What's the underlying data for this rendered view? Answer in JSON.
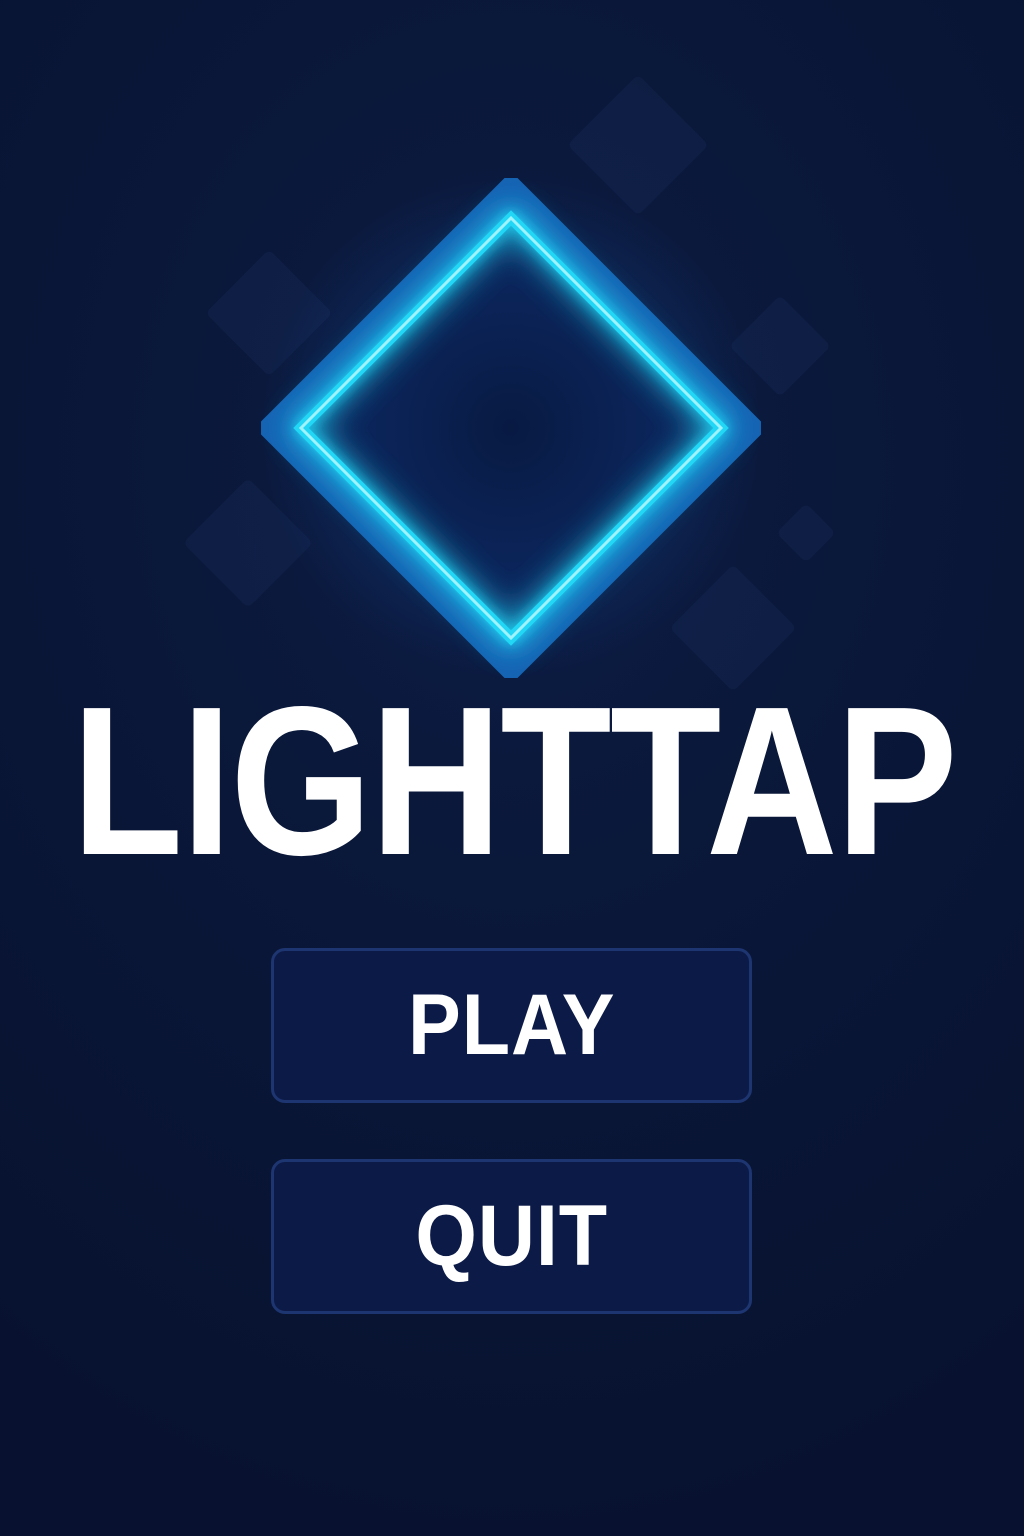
{
  "title": "LIGHTTAP",
  "logo": {
    "icon": "diamond-logo-icon",
    "neon_color": "#21d6f5",
    "outer_color": "#1662b2"
  },
  "menu": {
    "play_label": "PLAY",
    "quit_label": "QUIT"
  },
  "background": {
    "base_color": "#0a1738",
    "button_fill": "#0c1a47",
    "button_border": "#1d3570"
  }
}
